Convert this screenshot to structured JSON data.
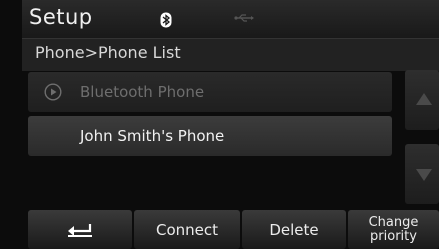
{
  "header": {
    "title": "Setup",
    "icons": [
      "bluetooth-icon",
      "usb-icon"
    ]
  },
  "breadcrumb": "Phone>Phone List",
  "phone_list": {
    "items": [
      {
        "label": "Bluetooth Phone",
        "icon": "play-icon",
        "state": "disabled"
      },
      {
        "label": "John Smith's Phone",
        "state": "normal"
      }
    ]
  },
  "scroll": {
    "up_icon": "triangle-up-icon",
    "down_icon": "triangle-down-icon"
  },
  "bottom_bar": {
    "back_icon": "back-arrow-icon",
    "connect_label": "Connect",
    "delete_label": "Delete",
    "change_priority_line1": "Change",
    "change_priority_line2": "priority"
  }
}
